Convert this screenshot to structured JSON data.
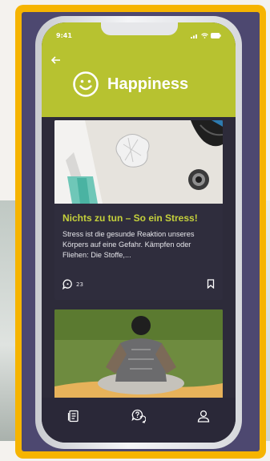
{
  "status": {
    "time": "9:41"
  },
  "header": {
    "title": "Happiness"
  },
  "card1": {
    "title": "Nichts zu tun – So ein Stress!",
    "excerpt": "Stress ist die gesunde Reaktion unseres Körpers auf eine Gefahr. Kämpfen oder Fliehen: Die Stoffe,...",
    "comment_count": "23"
  },
  "icons": {
    "back": "arrow-left-icon",
    "smile": "smiley-icon",
    "comment": "comment-icon",
    "bookmark": "bookmark-icon",
    "nav1": "document-icon",
    "nav2": "help-chat-icon",
    "nav3": "profile-icon"
  },
  "colors": {
    "accent": "#b7c230",
    "frame": "#f6b400",
    "background": "#4d4870",
    "card": "#2f2d3d"
  }
}
